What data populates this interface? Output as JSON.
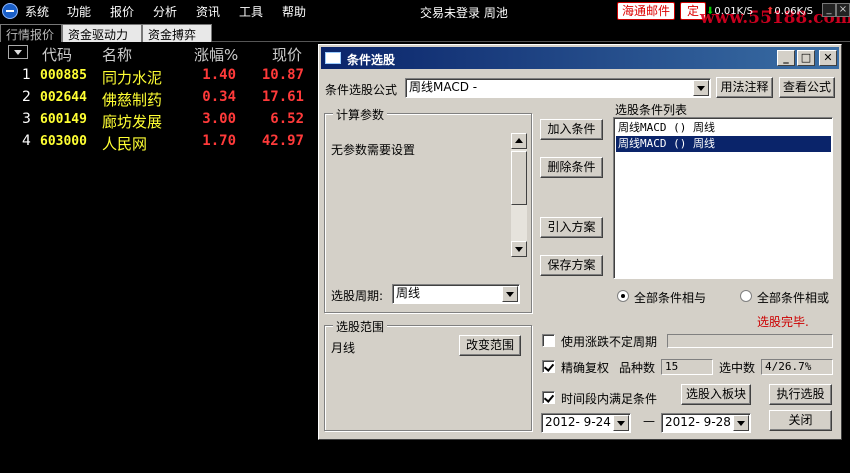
{
  "menu": [
    "系统",
    "功能",
    "报价",
    "分析",
    "资讯",
    "工具",
    "帮助"
  ],
  "status_text": "交易未登录 周池",
  "mail_label": "海通邮件",
  "fixed_label": "定",
  "speed_down": "0.01K/S",
  "speed_up": "0.06K/S",
  "watermark": "www.55188.com",
  "tabs": [
    "行情报价",
    "资金驱动力",
    "资金搏弈"
  ],
  "table": {
    "headers": [
      "代码",
      "名称",
      "涨幅%",
      "现价"
    ],
    "rows": [
      {
        "idx": "1",
        "code": "000885",
        "name": "同力水泥",
        "chg": "1.40",
        "price": "10.87"
      },
      {
        "idx": "2",
        "code": "002644",
        "name": "佛慈制药",
        "chg": "0.34",
        "price": "17.61"
      },
      {
        "idx": "3",
        "code": "600149",
        "name": "廊坊发展",
        "chg": "3.00",
        "price": "6.52"
      },
      {
        "idx": "4",
        "code": "603000",
        "name": "人民网",
        "chg": "1.70",
        "price": "42.97"
      }
    ]
  },
  "dialog": {
    "title": "条件选股",
    "formula_label": "条件选股公式",
    "formula_value": "周线MACD -",
    "usage_btn": "用法注释",
    "view_btn": "查看公式",
    "params_group": "计算参数",
    "params_text": "无参数需要设置",
    "period_label": "选股周期:",
    "period_value": "周线",
    "add_btn": "加入条件",
    "del_btn": "删除条件",
    "import_btn": "引入方案",
    "save_btn": "保存方案",
    "list_title": "选股条件列表",
    "conditions": [
      "周线MACD () 周线",
      "周线MACD () 周线"
    ],
    "radio_and": "全部条件相与",
    "radio_or": "全部条件相或",
    "done_text": "选股完毕.",
    "range_group": "选股范围",
    "range_value": "月线",
    "change_range_btn": "改变范围",
    "use_period_label": "使用涨跌不定周期",
    "exact_label": "精确复权",
    "count_label": "品种数",
    "count_value": "15",
    "selected_label": "选中数",
    "selected_value": "4/26.7%",
    "time_label": "时间段内满足条件",
    "to_board_btn": "选股入板块",
    "run_btn": "执行选股",
    "date_from": "2012- 9-24",
    "date_sep": "—",
    "date_to": "2012- 9-28",
    "close_btn": "关闭"
  },
  "colors": {
    "up": "#ff3a3a",
    "code": "#ffff33",
    "title_bar": "#0a246a",
    "done": "#cc0000"
  }
}
